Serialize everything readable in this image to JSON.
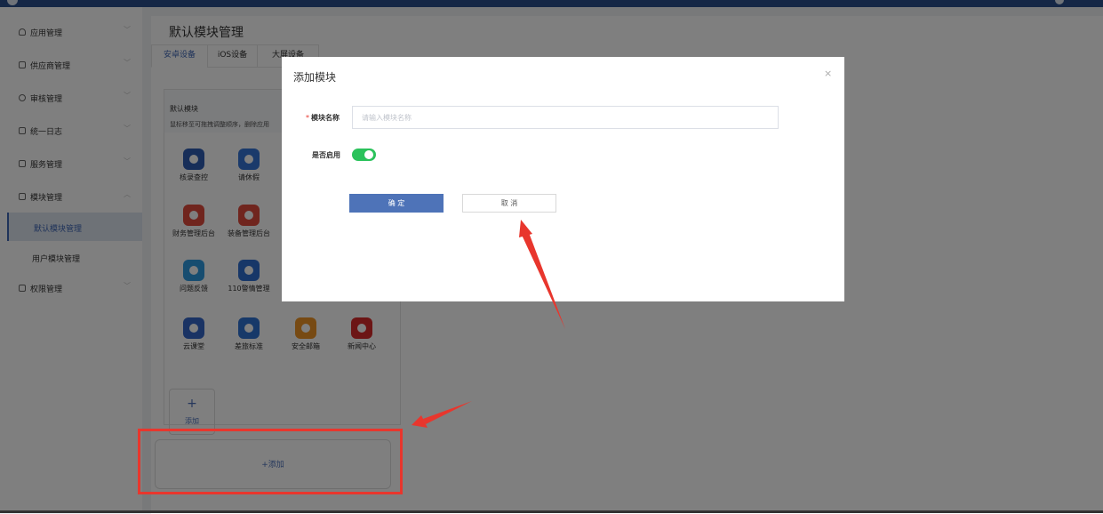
{
  "sidebar": {
    "items": [
      {
        "label": "应用管理",
        "icon": "user-icon"
      },
      {
        "label": "供应商管理",
        "icon": "supplier-icon"
      },
      {
        "label": "审核管理",
        "icon": "audit-icon"
      },
      {
        "label": "统一日志",
        "icon": "log-icon"
      },
      {
        "label": "服务管理",
        "icon": "service-icon"
      },
      {
        "label": "模块管理",
        "icon": "module-icon"
      }
    ],
    "sub_items": [
      {
        "label": "默认模块管理",
        "active": true
      },
      {
        "label": "用户模块管理",
        "active": false
      }
    ],
    "last_item": {
      "label": "权限管理",
      "icon": "permission-icon"
    }
  },
  "page": {
    "title": "默认模块管理",
    "tabs": [
      "安卓设备",
      "iOS设备",
      "大屏设备"
    ]
  },
  "panel": {
    "title": "默认模块",
    "hint": "鼠标移至可拖拽调整顺序，删除应用",
    "apps": [
      {
        "label": "核录查控",
        "color": "#2e5cb3"
      },
      {
        "label": "请休假",
        "color": "#3574d6"
      },
      {
        "label": "财务管理后台",
        "color": "#e04b3c"
      },
      {
        "label": "装备管理后台",
        "color": "#e04b3c"
      },
      {
        "label": "问题反馈",
        "color": "#2f9be0"
      },
      {
        "label": "110警情管理",
        "color": "#2f6fd0"
      },
      {
        "label": "云课堂",
        "color": "#3467c8"
      },
      {
        "label": "差旅标准",
        "color": "#2e73d3"
      },
      {
        "label": "安全邮箱",
        "color": "#ee9526"
      },
      {
        "label": "新闻中心",
        "color": "#d92a2a"
      }
    ],
    "add_plus": "+",
    "add_label": "添加"
  },
  "add_module": {
    "label": "+添加"
  },
  "modal": {
    "title": "添加模块",
    "close": "×",
    "name_label": "模块名称",
    "required_mark": "*",
    "name_placeholder": "请输入模块名称",
    "name_value": "",
    "enable_label": "是否启用",
    "enabled": true,
    "ok_label": "确 定",
    "cancel_label": "取 消"
  },
  "colors": {
    "accent": "#3e66b5",
    "switch_on": "#2bc25b",
    "annotation": "#e8362d"
  }
}
